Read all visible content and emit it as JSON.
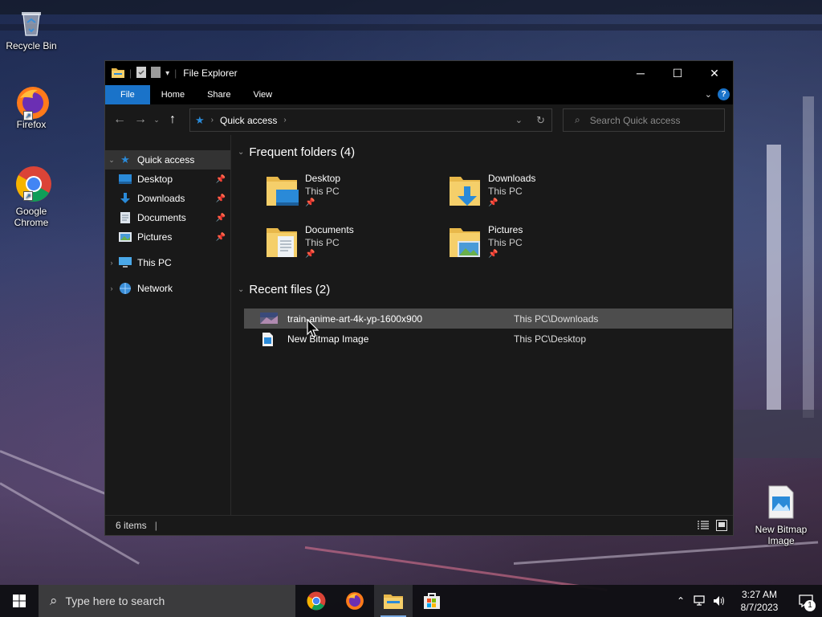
{
  "desktop": {
    "icons": [
      {
        "label": "Recycle Bin",
        "icon": "recycle-bin-icon"
      },
      {
        "label": "Firefox",
        "icon": "firefox-icon"
      },
      {
        "label": "Google Chrome",
        "icon": "chrome-icon"
      },
      {
        "label": "New Bitmap Image",
        "icon": "bitmap-file-icon"
      }
    ]
  },
  "window": {
    "title": "File Explorer",
    "controls": {
      "minimize": "─",
      "maximize": "☐",
      "close": "✕"
    }
  },
  "ribbon": {
    "tabs": [
      {
        "label": "File",
        "active": true
      },
      {
        "label": "Home"
      },
      {
        "label": "Share"
      },
      {
        "label": "View"
      }
    ],
    "help": "?"
  },
  "address": {
    "path": "Quick access",
    "search_placeholder": "Search Quick access"
  },
  "nav": {
    "quick_access": "Quick access",
    "pinned": [
      {
        "label": "Desktop",
        "icon": "desktop-icon"
      },
      {
        "label": "Downloads",
        "icon": "download-arrow-icon"
      },
      {
        "label": "Documents",
        "icon": "documents-icon"
      },
      {
        "label": "Pictures",
        "icon": "pictures-icon"
      }
    ],
    "this_pc": "This PC",
    "network": "Network"
  },
  "frequent": {
    "header": "Frequent folders (4)",
    "folders": [
      {
        "name": "Desktop",
        "location": "This PC"
      },
      {
        "name": "Downloads",
        "location": "This PC"
      },
      {
        "name": "Documents",
        "location": "This PC"
      },
      {
        "name": "Pictures",
        "location": "This PC"
      }
    ]
  },
  "recent": {
    "header": "Recent files (2)",
    "files": [
      {
        "name": "train-anime-art-4k-yp-1600x900",
        "path": "This PC\\Downloads"
      },
      {
        "name": "New Bitmap Image",
        "path": "This PC\\Desktop"
      }
    ]
  },
  "status": {
    "items": "6 items"
  },
  "taskbar": {
    "search_placeholder": "Type here to search",
    "apps": [
      "chrome-icon",
      "firefox-icon",
      "file-explorer-icon",
      "store-icon"
    ],
    "time": "3:27 AM",
    "date": "8/7/2023",
    "notifications": "1"
  },
  "colors": {
    "accent": "#1a73c9",
    "window_bg": "#191919",
    "titlebar_bg": "#000000",
    "hover_row": "#4d4d4d"
  }
}
